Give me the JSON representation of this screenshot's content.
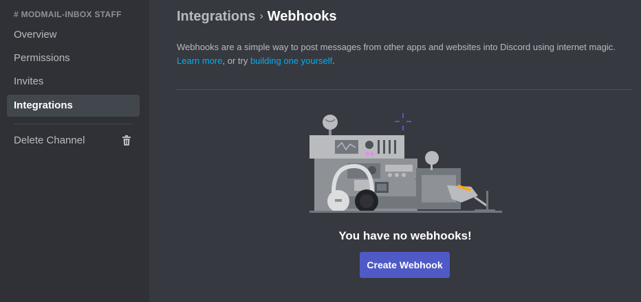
{
  "sidebar": {
    "header": "# MODMAIL-INBOX STAFF",
    "items": [
      {
        "label": "Overview",
        "active": false
      },
      {
        "label": "Permissions",
        "active": false
      },
      {
        "label": "Invites",
        "active": false
      },
      {
        "label": "Integrations",
        "active": true
      }
    ],
    "delete_label": "Delete Channel",
    "delete_icon": "trash-icon"
  },
  "header": {
    "breadcrumb": "Integrations",
    "separator": "›",
    "current": "Webhooks"
  },
  "description": {
    "text": "Webhooks are a simple way to post messages from other apps and websites into Discord using internet magic.",
    "link1": "Learn more",
    "middle": ", or try ",
    "link2": "building one yourself",
    "end": "."
  },
  "empty_state": {
    "illustration": "webhook-machine-illustration",
    "title": "You have no webhooks!",
    "button": "Create Webhook"
  },
  "colors": {
    "sidebar_bg": "#2f3136",
    "main_bg": "#36393f",
    "link": "#00aff4",
    "button": "#4f5ac7"
  }
}
